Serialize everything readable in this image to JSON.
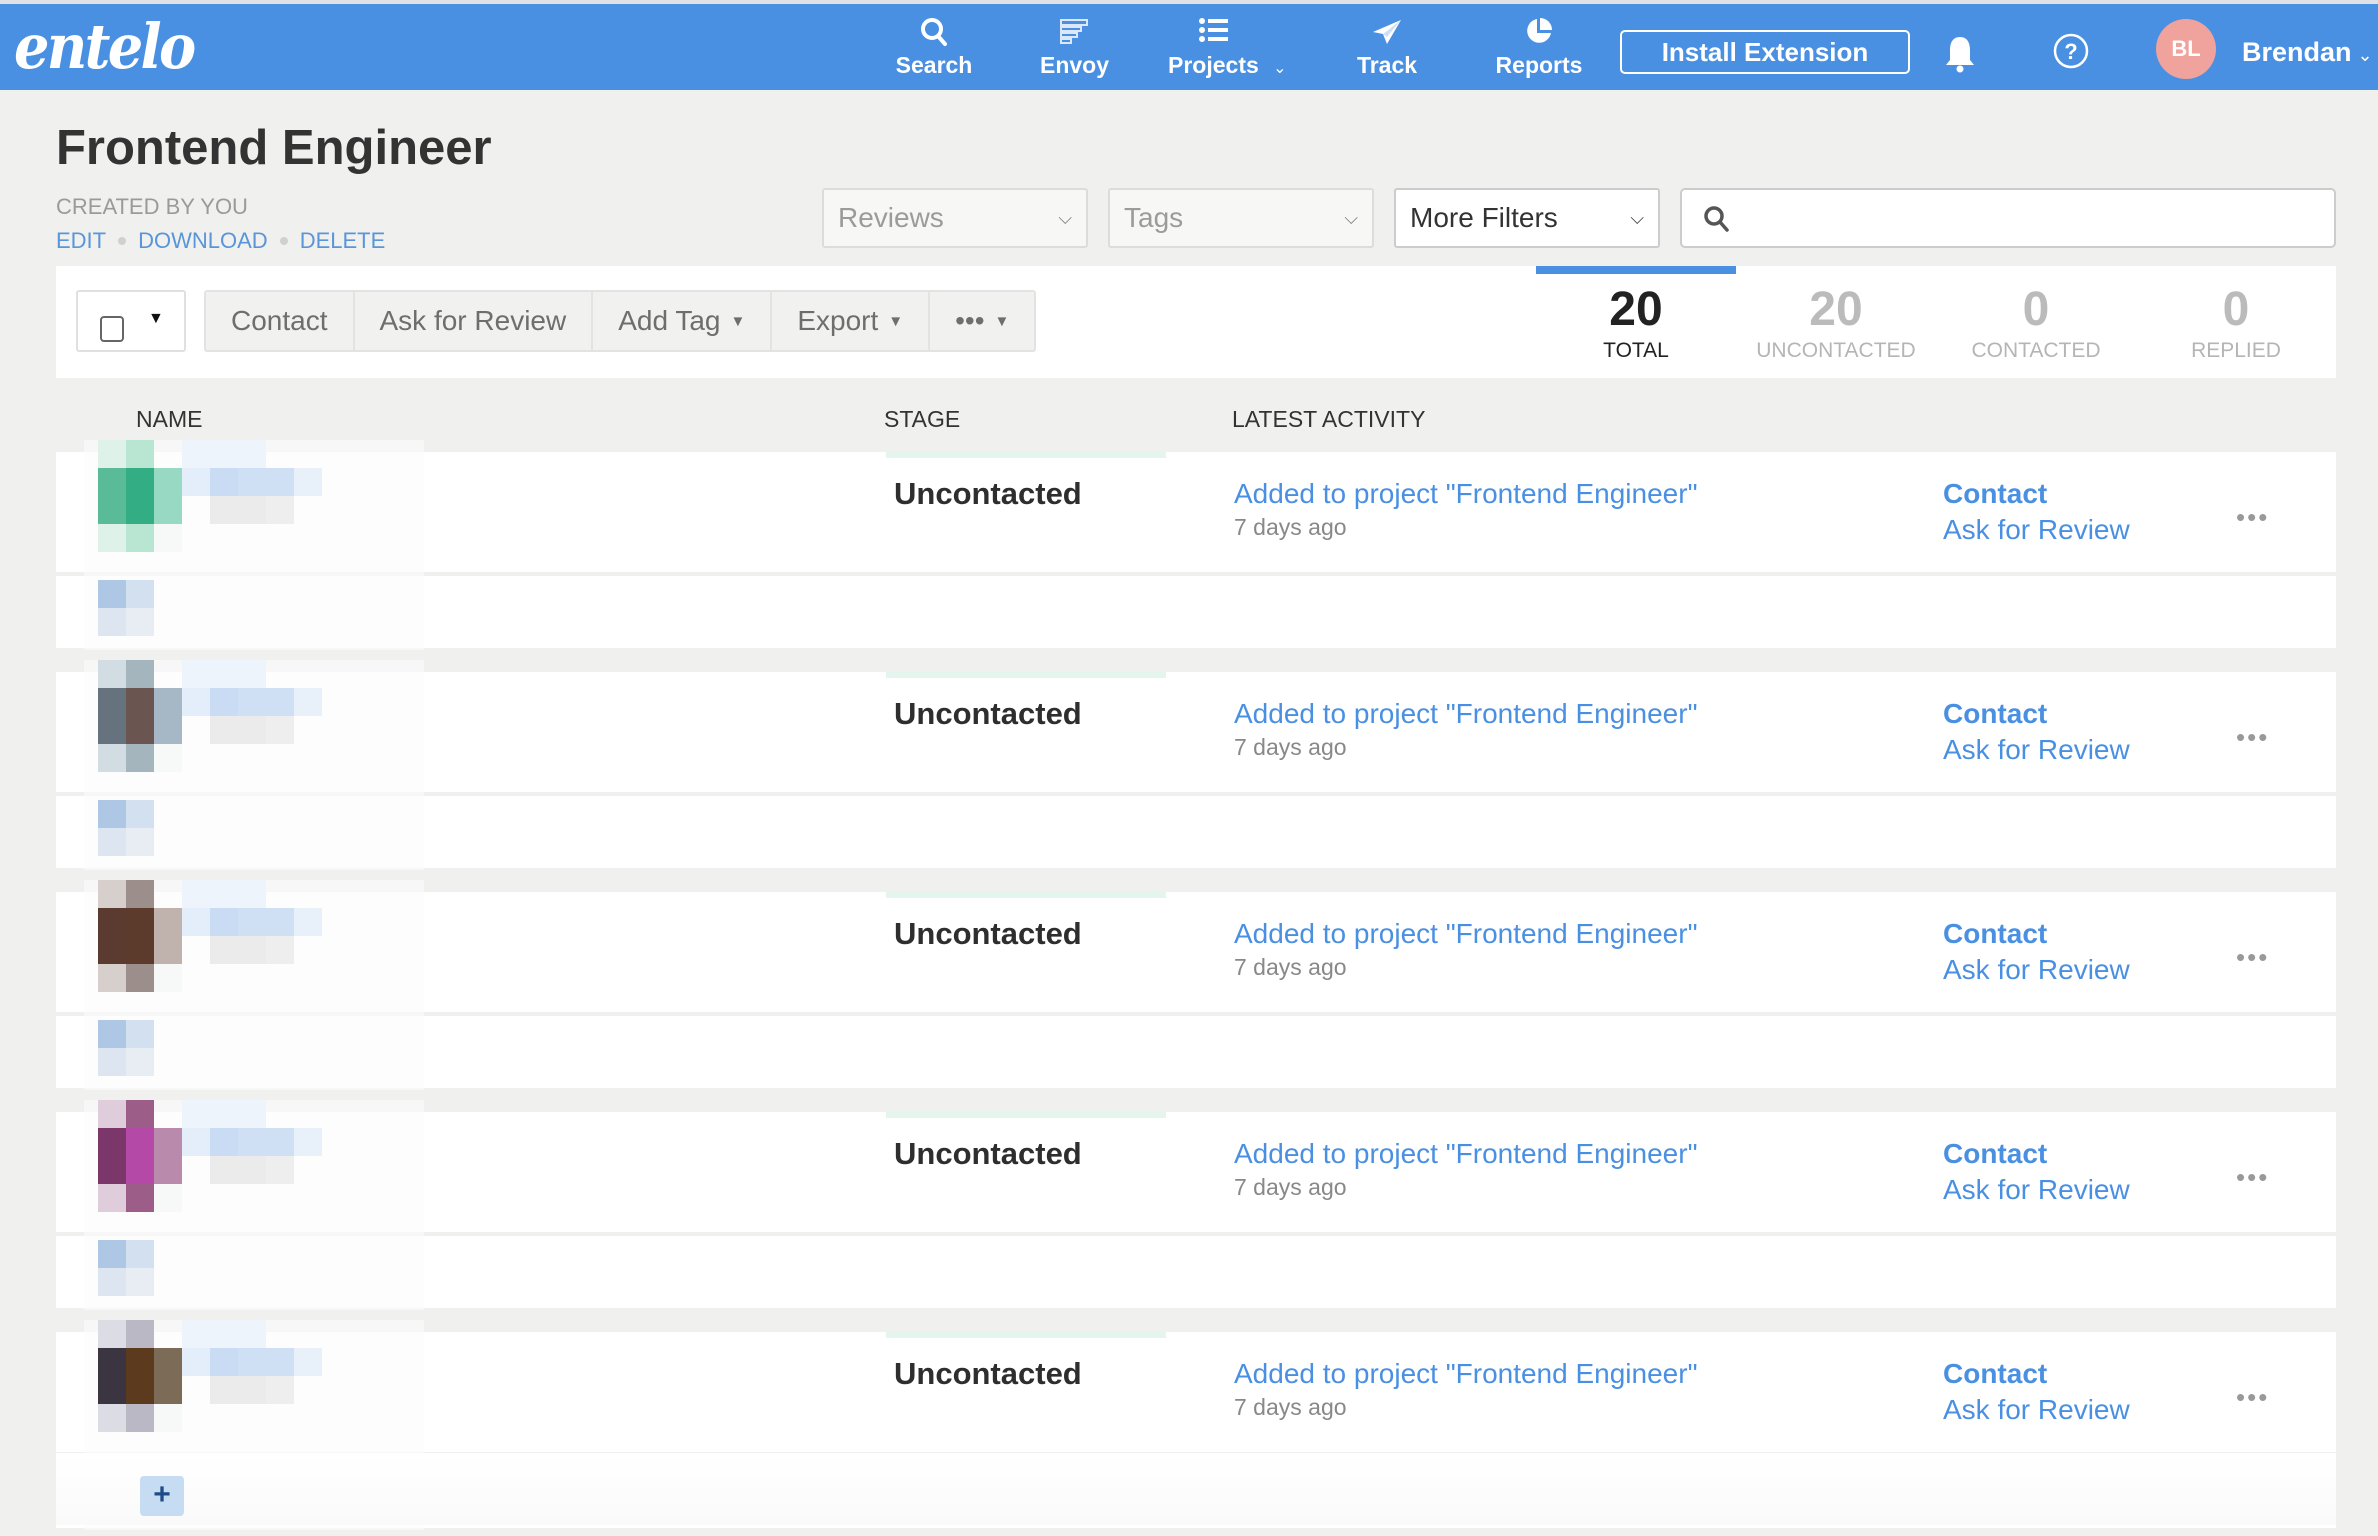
{
  "nav": {
    "logo": "entelo",
    "items": [
      {
        "label": "Search",
        "icon": "search-icon"
      },
      {
        "label": "Envoy",
        "icon": "envoy-icon"
      },
      {
        "label": "Projects",
        "icon": "list-icon",
        "has_dropdown": true
      },
      {
        "label": "Track",
        "icon": "paper-plane-icon"
      },
      {
        "label": "Reports",
        "icon": "pie-chart-icon"
      }
    ],
    "install_extension": "Install Extension",
    "avatar_initials": "BL",
    "user_name": "Brendan",
    "chevron": "⌄",
    "colors": {
      "bar": "#4a90e2",
      "avatar": "#f0a29c"
    }
  },
  "project": {
    "title": "Frontend Engineer",
    "created_by": "CREATED BY YOU",
    "links": [
      "EDIT",
      "DOWNLOAD",
      "DELETE"
    ]
  },
  "filters": {
    "reviews": "Reviews",
    "tags": "Tags",
    "more_filters": "More Filters",
    "search_placeholder": "",
    "search_value": ""
  },
  "toolbar": {
    "contact": "Contact",
    "ask_for_review": "Ask for Review",
    "add_tag": "Add Tag",
    "export": "Export",
    "more": "•••"
  },
  "stats": [
    {
      "value": "20",
      "label": "TOTAL",
      "active": true
    },
    {
      "value": "20",
      "label": "UNCONTACTED",
      "active": false
    },
    {
      "value": "0",
      "label": "CONTACTED",
      "active": false
    },
    {
      "value": "0",
      "label": "REPLIED",
      "active": false
    }
  ],
  "table": {
    "headers": {
      "name": "NAME",
      "stage": "STAGE",
      "latest_activity": "LATEST ACTIVITY"
    },
    "rows": [
      {
        "name": "[pixelated]",
        "stage": "Uncontacted",
        "activity": "Added to project \"Frontend Engineer\"",
        "time": "7 days ago",
        "action_contact": "Contact",
        "action_review": "Ask for Review",
        "more": "•••"
      },
      {
        "name": "[pixelated]",
        "stage": "Uncontacted",
        "activity": "Added to project \"Frontend Engineer\"",
        "time": "7 days ago",
        "action_contact": "Contact",
        "action_review": "Ask for Review",
        "more": "•••"
      },
      {
        "name": "[pixelated]",
        "stage": "Uncontacted",
        "activity": "Added to project \"Frontend Engineer\"",
        "time": "7 days ago",
        "action_contact": "Contact",
        "action_review": "Ask for Review",
        "more": "•••"
      },
      {
        "name": "[pixelated]",
        "stage": "Uncontacted",
        "activity": "Added to project \"Frontend Engineer\"",
        "time": "7 days ago",
        "action_contact": "Contact",
        "action_review": "Ask for Review",
        "more": "•••"
      },
      {
        "name": "[pixelated]",
        "stage": "Uncontacted",
        "activity": "Added to project \"Frontend Engineer\"",
        "time": "7 days ago",
        "action_contact": "Contact",
        "action_review": "Ask for Review",
        "more": "•••"
      }
    ],
    "add_button": "+"
  }
}
